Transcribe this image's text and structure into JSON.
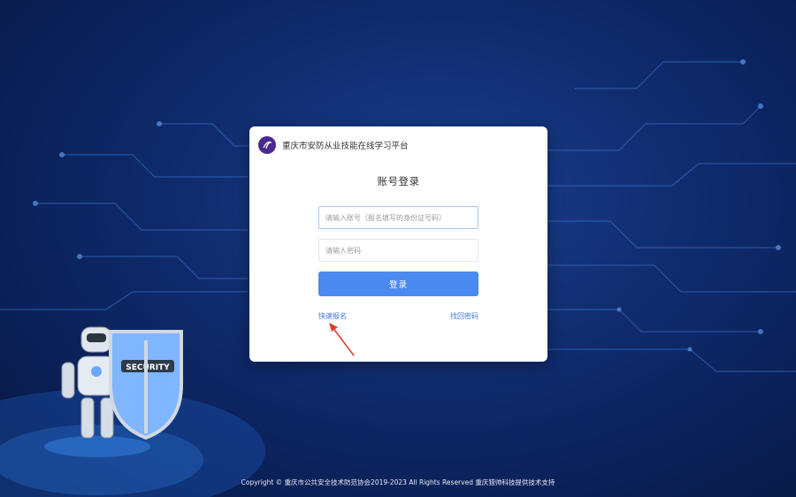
{
  "header": {
    "platform_title": "重庆市安防从业技能在线学习平台",
    "logo_icon": "association-logo-icon"
  },
  "login": {
    "title": "账号登录",
    "account_placeholder": "请输入账号（报名填写的身份证号码）",
    "account_value": "",
    "password_placeholder": "请输入密码",
    "password_value": "",
    "submit_label": "登录",
    "quick_register_label": "快速报名",
    "forgot_password_label": "找回密码"
  },
  "decoration": {
    "robot_shield_text": "SECURITY"
  },
  "footer": {
    "copyright": "Copyright © 重庆市公共安全技术防范协会2019-2023 All Rights Reserved 重庆猎帅科技提供技术支持"
  },
  "colors": {
    "background": "#0f2a6b",
    "primary_button": "#4a89ef",
    "link": "#3b78d8",
    "annotation_arrow": "#e53a2f"
  }
}
